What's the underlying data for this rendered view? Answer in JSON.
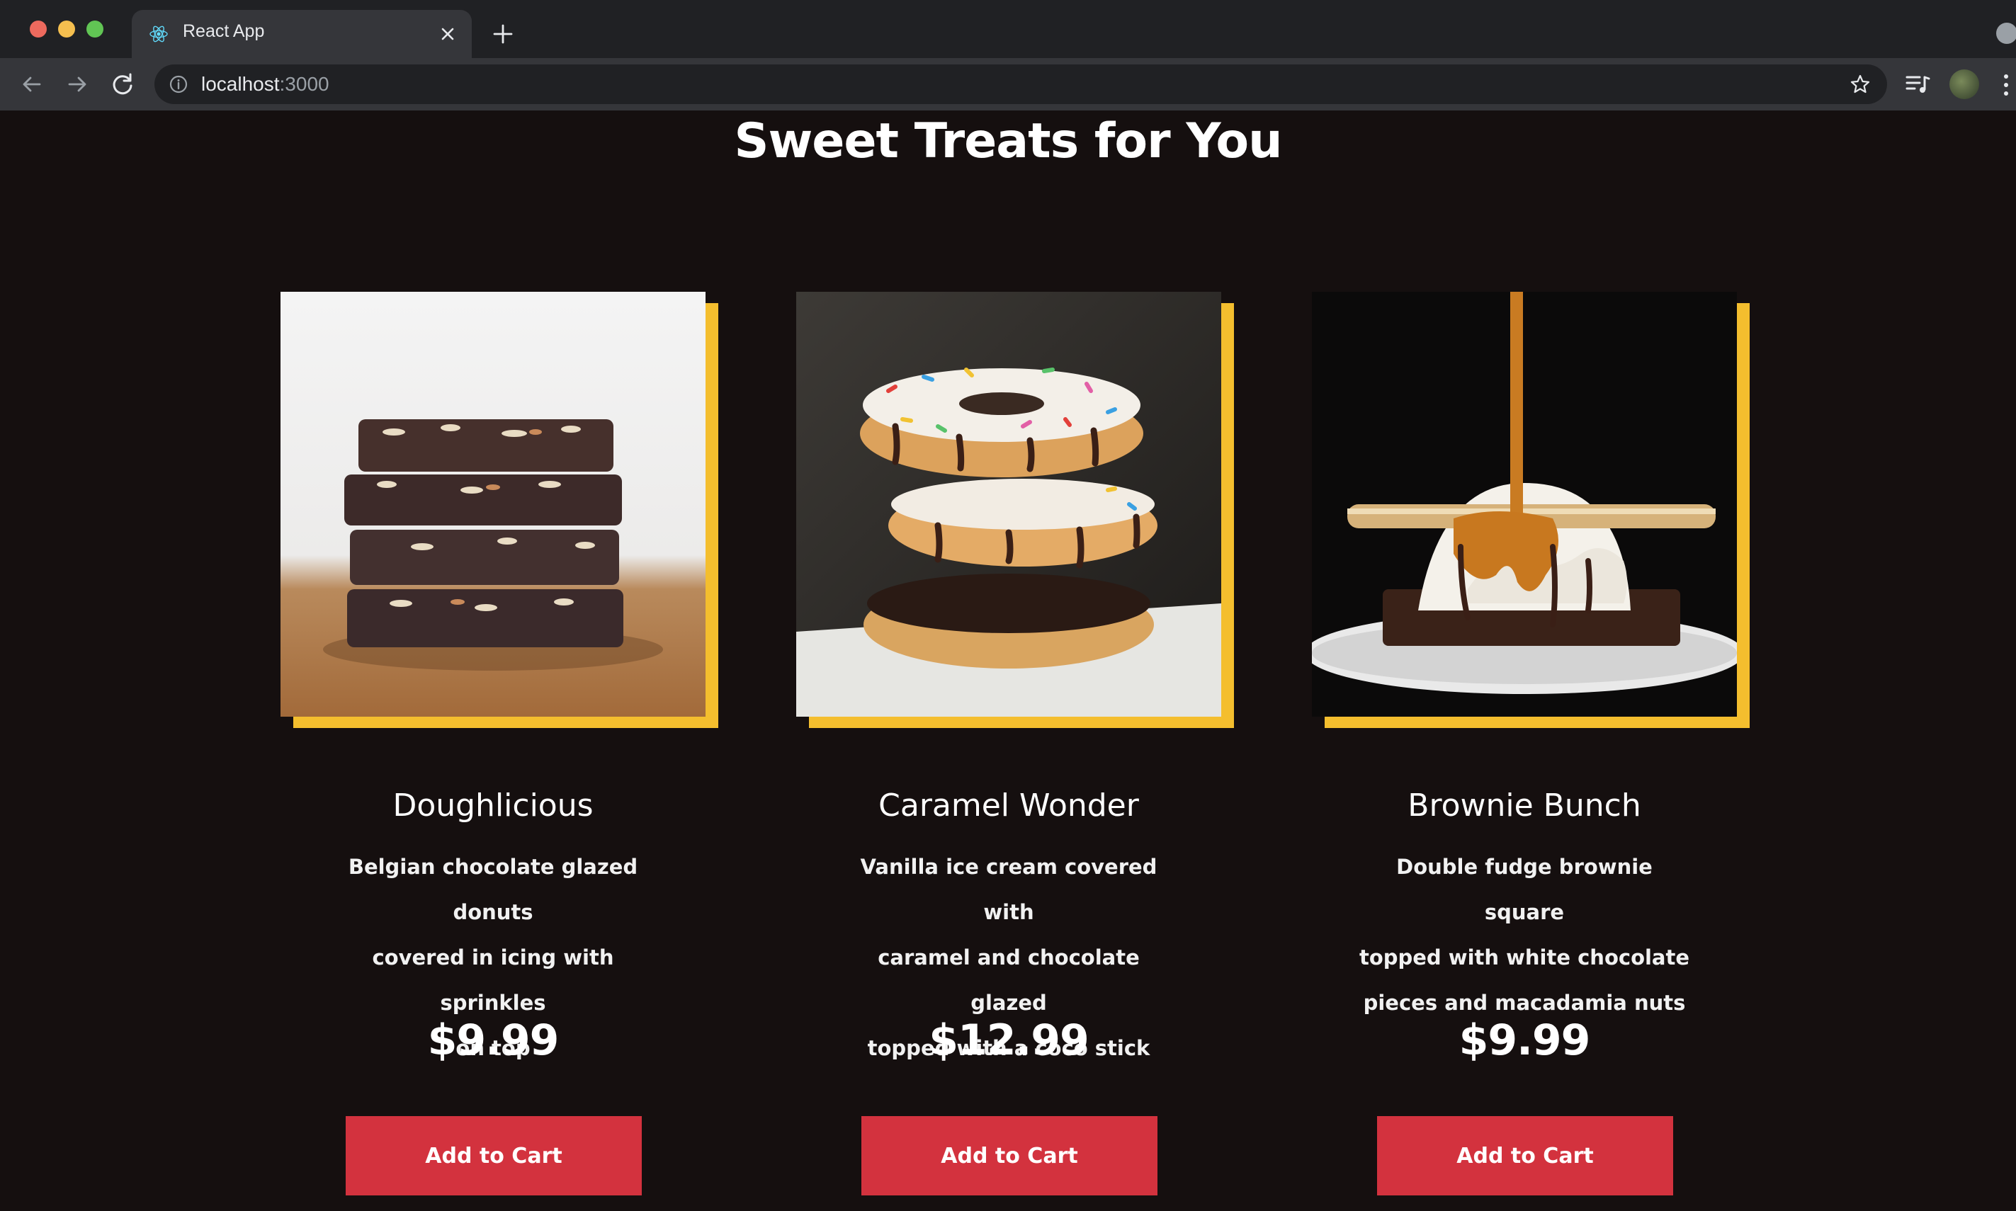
{
  "browser": {
    "tab_title": "React App",
    "url_host": "localhost",
    "url_port": ":3000"
  },
  "page": {
    "title": "Sweet Treats for You"
  },
  "products": [
    {
      "name": "Doughlicious",
      "description_lines": [
        "Belgian chocolate glazed donuts",
        "covered in icing with sprinkles",
        "on top"
      ],
      "price": "$9.99",
      "button_label": "Add to Cart",
      "image": "brownie-stack-photo"
    },
    {
      "name": "Caramel Wonder",
      "description_lines": [
        "Vanilla ice cream covered with",
        "caramel and chocolate glazed",
        "topped with a coco stick"
      ],
      "price": "$12.99",
      "button_label": "Add to Cart",
      "image": "donut-stack-photo"
    },
    {
      "name": "Brownie Bunch",
      "description_lines": [
        "Double fudge brownie square",
        "topped with white chocolate",
        "pieces and macadamia nuts"
      ],
      "price": "$9.99",
      "button_label": "Add to Cart",
      "image": "ice-cream-caramel-photo"
    }
  ],
  "colors": {
    "background": "#150f0f",
    "accent_frame": "#f4be2e",
    "button": "#d3323e"
  }
}
